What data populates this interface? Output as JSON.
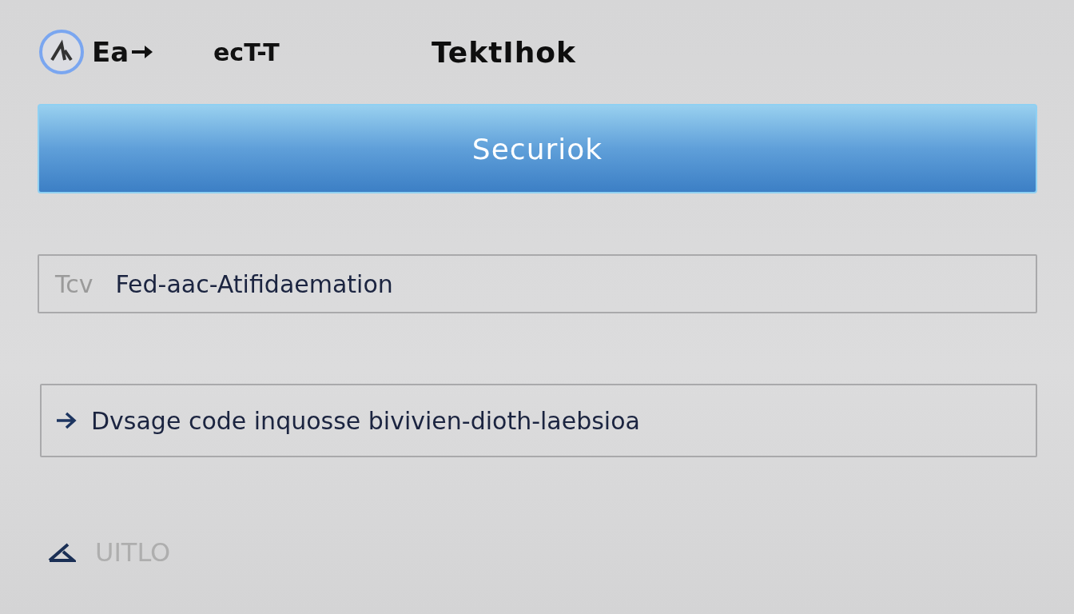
{
  "header": {
    "logo_text": "Ea",
    "nav_item": "ecT-T",
    "title": "TektIhok"
  },
  "primary_button": {
    "label": "Securiok"
  },
  "fields": [
    {
      "kind": "text",
      "label": "Tcv",
      "value": "Fed-aac-Atifidaemation"
    },
    {
      "kind": "link",
      "value": "Dvsage code inquosse bivivien-dioth-laebsioa"
    }
  ],
  "footer_item": {
    "label": "UITLO",
    "disabled": true
  }
}
